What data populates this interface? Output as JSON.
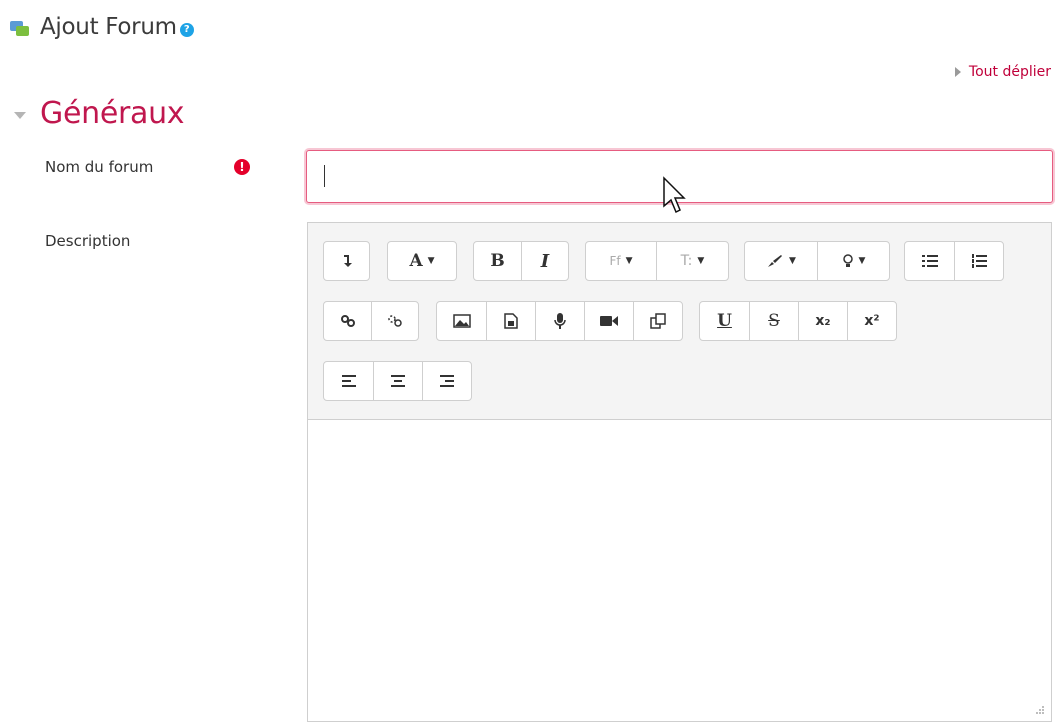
{
  "header": {
    "title": "Ajout Forum",
    "icon": "forum-icon",
    "help_icon": "help-icon"
  },
  "expand_all": {
    "label": "Tout déplier"
  },
  "section": {
    "title": "Généraux"
  },
  "form": {
    "name_label": "Nom du forum",
    "name_value": "",
    "required_icon": "!",
    "description_label": "Description"
  },
  "toolbar": {
    "bold": "B",
    "italic": "I",
    "underline": "U",
    "strike": "S",
    "subscript": "x₂",
    "superscript": "x²",
    "font_color": "A",
    "font_family": "Ff",
    "font_size": "T:"
  },
  "colors": {
    "accent": "#c0174e",
    "link": "#c0003a",
    "required": "#e4002b",
    "input_border": "#e65c80",
    "help": "#1ea3e6"
  }
}
